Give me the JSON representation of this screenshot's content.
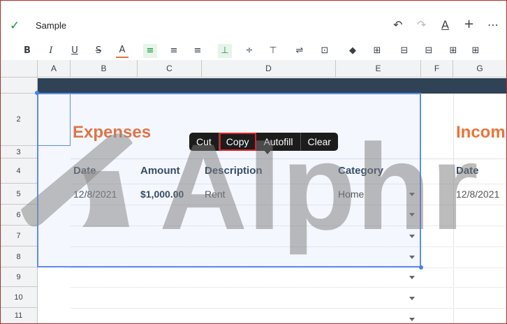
{
  "app": {
    "status_icon": "check-icon",
    "doc_title": "Sample"
  },
  "topbar_icons": [
    "undo-icon",
    "redo-icon",
    "text-format-icon",
    "add-icon",
    "more-icon"
  ],
  "format_toolbar": {
    "bold": "B",
    "italic": "I",
    "underline": "U",
    "strikethrough": "S",
    "text_color": "A",
    "icons": [
      "align-left-icon",
      "align-center-icon",
      "align-right-icon",
      "valign-bottom-icon",
      "valign-middle-icon",
      "valign-top-icon",
      "wrap-icon",
      "merge-icon",
      "fill-color-icon",
      "borders-icon",
      "insert-row-above-icon",
      "insert-row-below-icon",
      "insert-col-left-icon",
      "insert-col-right-icon"
    ]
  },
  "columns": [
    "A",
    "B",
    "C",
    "D",
    "E",
    "F",
    "G"
  ],
  "rows": [
    "2",
    "3",
    "4",
    "5",
    "6",
    "7",
    "8",
    "9",
    "10",
    "11"
  ],
  "sheet": {
    "expenses_title": "Expenses",
    "income_title": "Incom",
    "headers": {
      "date": "Date",
      "amount": "Amount",
      "description": "Description",
      "category": "Category",
      "date2": "Date"
    },
    "row5": {
      "date": "12/8/2021",
      "amount": "$1,000.00",
      "description": "Rent",
      "category": "Home",
      "date2": "12/8/2021"
    }
  },
  "context_menu": {
    "items": [
      "Cut",
      "Copy",
      "Autofill",
      "Clear"
    ],
    "highlighted": "Copy"
  },
  "watermark": {
    "text": "Alphr"
  },
  "colors": {
    "accent_green": "#1e8e3e",
    "selection_blue": "#5b8def",
    "title_orange": "#e8743b",
    "header_band": "#2f4256"
  }
}
